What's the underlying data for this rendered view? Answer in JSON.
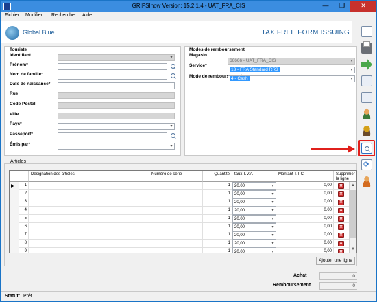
{
  "window": {
    "title": "GRIPSInow Version: 15.2.1.4 - UAT_FRA_CIS",
    "minimize": "—",
    "maximize": "❐",
    "close": "✕"
  },
  "menu": [
    "Fichier",
    "Modifier",
    "Rechercher",
    "Aide"
  ],
  "header": {
    "logo_text": "Global Blue",
    "page_title": "TAX FREE FORM ISSUING"
  },
  "tourist": {
    "section_label": "Touriste",
    "identifiant": {
      "label": "Identifiant",
      "value": ""
    },
    "prenom": {
      "label": "Prénom*",
      "value": ""
    },
    "nom": {
      "label": "Nom de famille*",
      "value": ""
    },
    "date_naissance": {
      "label": "Date de naissance*",
      "value": ""
    },
    "rue": {
      "label": "Rue",
      "value": ""
    },
    "code_postal": {
      "label": "Code Postal",
      "value": ""
    },
    "ville": {
      "label": "Ville",
      "value": ""
    },
    "pays": {
      "label": "Pays*",
      "value": ""
    },
    "passeport": {
      "label": "Passeport*",
      "value": ""
    },
    "emis_par": {
      "label": "Émis par*",
      "value": ""
    }
  },
  "refund": {
    "section_label": "Modes de remboursement",
    "magasin": {
      "label": "Magasin",
      "value": "66666 - UAT_FRA_CIS"
    },
    "service": {
      "label": "Service*",
      "value": "13 - FRA Standard RR3"
    },
    "mode": {
      "label": "Mode de remboursement*",
      "value": "4 - Cash"
    }
  },
  "articles": {
    "section_label": "Articles",
    "columns": {
      "designation": "Désignation des articles",
      "serie": "Numéro de série",
      "quantite": "Quantité",
      "tva": "taux T.V.A",
      "montant": "Montant T.T.C",
      "supprimer": "Supprimer la ligne"
    },
    "rows": [
      {
        "n": "1",
        "qty": "1",
        "tva": "20,00",
        "amount": "0,00"
      },
      {
        "n": "2",
        "qty": "1",
        "tva": "20,00",
        "amount": "0,00"
      },
      {
        "n": "3",
        "qty": "1",
        "tva": "20,00",
        "amount": "0,00"
      },
      {
        "n": "4",
        "qty": "1",
        "tva": "20,00",
        "amount": "0,00"
      },
      {
        "n": "5",
        "qty": "1",
        "tva": "20,00",
        "amount": "0,00"
      },
      {
        "n": "6",
        "qty": "1",
        "tva": "20,00",
        "amount": "0,00"
      },
      {
        "n": "7",
        "qty": "1",
        "tva": "20,00",
        "amount": "0,00"
      },
      {
        "n": "8",
        "qty": "1",
        "tva": "20,00",
        "amount": "0,00"
      },
      {
        "n": "9",
        "qty": "1",
        "tva": "20,00",
        "amount": "0,00"
      }
    ],
    "delete_glyph": "✕",
    "add_line_label": "Ajouter une ligne"
  },
  "totals": {
    "achat": {
      "label": "Achat",
      "value": "0"
    },
    "remboursement": {
      "label": "Remboursement",
      "value": "0"
    }
  },
  "status": {
    "label": "Statut:",
    "value": "Prêt..."
  },
  "toolbar_icons": [
    "new-document-icon",
    "print-icon",
    "forward-icon",
    "page-icon",
    "document-icon",
    "people-icon",
    "coins-icon",
    "search-document-icon",
    "refresh-icon",
    "person-icon"
  ]
}
